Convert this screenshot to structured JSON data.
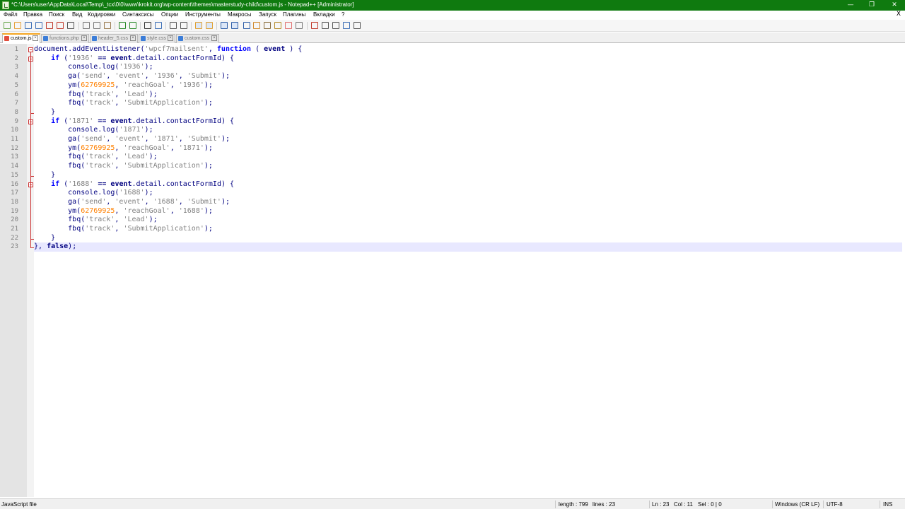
{
  "window": {
    "title": "*C:\\Users\\user\\AppData\\Local\\Temp\\_tcx\\0\\0\\www\\krokit.org\\wp-content\\themes\\masterstudy-child\\custom.js - Notepad++ [Administrator]",
    "minimize": "—",
    "maximize": "❐",
    "close": "✕"
  },
  "menu": {
    "items": [
      "Файл",
      "Правка",
      "Поиск",
      "Вид",
      "Кодировки",
      "Синтаксисы",
      "Опции",
      "Инструменты",
      "Макросы",
      "Запуск",
      "Плагины",
      "Вкладки",
      "?"
    ],
    "close_doc": "X"
  },
  "toolbar": {
    "icons": [
      "new-file-icon",
      "open-file-icon",
      "save-icon",
      "save-all-icon",
      "close-icon",
      "close-all-icon",
      "print-icon",
      "cut-icon",
      "copy-icon",
      "paste-icon",
      "undo-icon",
      "redo-icon",
      "find-icon",
      "replace-icon",
      "zoom-in-icon",
      "zoom-out-icon",
      "sync-vertical-icon",
      "sync-horizontal-icon",
      "word-wrap-icon",
      "show-all-chars-icon",
      "indent-guide-icon",
      "user-defined-lang-icon",
      "doc-map-icon",
      "function-list-icon",
      "folder-workspace-icon",
      "monitoring-icon",
      "record-macro-icon",
      "stop-macro-icon",
      "play-macro-icon",
      "run-macro-multiple-icon",
      "save-macro-icon"
    ]
  },
  "tabs": [
    {
      "label": "custom.js",
      "active": true
    },
    {
      "label": "functions.php",
      "active": false
    },
    {
      "label": "header_5.css",
      "active": false
    },
    {
      "label": "style.css",
      "active": false
    },
    {
      "label": "custom.css",
      "active": false
    }
  ],
  "code": {
    "lines": [
      [
        [
          "id",
          "document.addEventListener("
        ],
        [
          "str",
          "'wpcf7mailsent'"
        ],
        [
          "id",
          ", "
        ],
        [
          "kw",
          "function"
        ],
        [
          "id",
          " ( "
        ],
        [
          "op",
          "event"
        ],
        [
          "id",
          " ) {"
        ]
      ],
      [
        [
          "id",
          "    "
        ],
        [
          "kw",
          "if"
        ],
        [
          "id",
          " ("
        ],
        [
          "str",
          "'1936'"
        ],
        [
          "id",
          " "
        ],
        [
          "op",
          "=="
        ],
        [
          "id",
          " "
        ],
        [
          "op",
          "event"
        ],
        [
          "id",
          ".detail.contactFormId) {"
        ]
      ],
      [
        [
          "id",
          "        console.log("
        ],
        [
          "str",
          "'1936'"
        ],
        [
          "id",
          ");"
        ]
      ],
      [
        [
          "id",
          "        ga("
        ],
        [
          "str",
          "'send'"
        ],
        [
          "id",
          ", "
        ],
        [
          "str",
          "'event'"
        ],
        [
          "id",
          ", "
        ],
        [
          "str",
          "'1936'"
        ],
        [
          "id",
          ", "
        ],
        [
          "str",
          "'Submit'"
        ],
        [
          "id",
          ");"
        ]
      ],
      [
        [
          "id",
          "        ym("
        ],
        [
          "num",
          "62769925"
        ],
        [
          "id",
          ", "
        ],
        [
          "str",
          "'reachGoal'"
        ],
        [
          "id",
          ", "
        ],
        [
          "str",
          "'1936'"
        ],
        [
          "id",
          ");"
        ]
      ],
      [
        [
          "id",
          "        fbq("
        ],
        [
          "str",
          "'track'"
        ],
        [
          "id",
          ", "
        ],
        [
          "str",
          "'Lead'"
        ],
        [
          "id",
          ");"
        ]
      ],
      [
        [
          "id",
          "        fbq("
        ],
        [
          "str",
          "'track'"
        ],
        [
          "id",
          ", "
        ],
        [
          "str",
          "'SubmitApplication'"
        ],
        [
          "id",
          ");"
        ]
      ],
      [
        [
          "id",
          "    }"
        ]
      ],
      [
        [
          "id",
          "    "
        ],
        [
          "kw",
          "if"
        ],
        [
          "id",
          " ("
        ],
        [
          "str",
          "'1871'"
        ],
        [
          "id",
          " "
        ],
        [
          "op",
          "=="
        ],
        [
          "id",
          " "
        ],
        [
          "op",
          "event"
        ],
        [
          "id",
          ".detail.contactFormId) {"
        ]
      ],
      [
        [
          "id",
          "        console.log("
        ],
        [
          "str",
          "'1871'"
        ],
        [
          "id",
          ");"
        ]
      ],
      [
        [
          "id",
          "        ga("
        ],
        [
          "str",
          "'send'"
        ],
        [
          "id",
          ", "
        ],
        [
          "str",
          "'event'"
        ],
        [
          "id",
          ", "
        ],
        [
          "str",
          "'1871'"
        ],
        [
          "id",
          ", "
        ],
        [
          "str",
          "'Submit'"
        ],
        [
          "id",
          ");"
        ]
      ],
      [
        [
          "id",
          "        ym("
        ],
        [
          "num",
          "62769925"
        ],
        [
          "id",
          ", "
        ],
        [
          "str",
          "'reachGoal'"
        ],
        [
          "id",
          ", "
        ],
        [
          "str",
          "'1871'"
        ],
        [
          "id",
          ");"
        ]
      ],
      [
        [
          "id",
          "        fbq("
        ],
        [
          "str",
          "'track'"
        ],
        [
          "id",
          ", "
        ],
        [
          "str",
          "'Lead'"
        ],
        [
          "id",
          ");"
        ]
      ],
      [
        [
          "id",
          "        fbq("
        ],
        [
          "str",
          "'track'"
        ],
        [
          "id",
          ", "
        ],
        [
          "str",
          "'SubmitApplication'"
        ],
        [
          "id",
          ");"
        ]
      ],
      [
        [
          "id",
          "    }"
        ]
      ],
      [
        [
          "id",
          "    "
        ],
        [
          "kw",
          "if"
        ],
        [
          "id",
          " ("
        ],
        [
          "str",
          "'1688'"
        ],
        [
          "id",
          " "
        ],
        [
          "op",
          "=="
        ],
        [
          "id",
          " "
        ],
        [
          "op",
          "event"
        ],
        [
          "id",
          ".detail.contactFormId) {"
        ]
      ],
      [
        [
          "id",
          "        console.log("
        ],
        [
          "str",
          "'1688'"
        ],
        [
          "id",
          ");"
        ]
      ],
      [
        [
          "id",
          "        ga("
        ],
        [
          "str",
          "'send'"
        ],
        [
          "id",
          ", "
        ],
        [
          "str",
          "'event'"
        ],
        [
          "id",
          ", "
        ],
        [
          "str",
          "'1688'"
        ],
        [
          "id",
          ", "
        ],
        [
          "str",
          "'Submit'"
        ],
        [
          "id",
          ");"
        ]
      ],
      [
        [
          "id",
          "        ym("
        ],
        [
          "num",
          "62769925"
        ],
        [
          "id",
          ", "
        ],
        [
          "str",
          "'reachGoal'"
        ],
        [
          "id",
          ", "
        ],
        [
          "str",
          "'1688'"
        ],
        [
          "id",
          ");"
        ]
      ],
      [
        [
          "id",
          "        fbq("
        ],
        [
          "str",
          "'track'"
        ],
        [
          "id",
          ", "
        ],
        [
          "str",
          "'Lead'"
        ],
        [
          "id",
          ");"
        ]
      ],
      [
        [
          "id",
          "        fbq("
        ],
        [
          "str",
          "'track'"
        ],
        [
          "id",
          ", "
        ],
        [
          "str",
          "'SubmitApplication'"
        ],
        [
          "id",
          ");"
        ]
      ],
      [
        [
          "id",
          "    }"
        ]
      ],
      [
        [
          "id",
          "}, "
        ],
        [
          "op",
          "false"
        ],
        [
          "id",
          ");"
        ]
      ]
    ],
    "line_numbers": [
      "1",
      "2",
      "3",
      "4",
      "5",
      "6",
      "7",
      "8",
      "9",
      "10",
      "11",
      "12",
      "13",
      "14",
      "15",
      "16",
      "17",
      "18",
      "19",
      "20",
      "21",
      "22",
      "23"
    ],
    "current_line": 23
  },
  "status": {
    "file_type": "JavaScript file",
    "length": "length : 799",
    "lines": "lines : 23",
    "ln": "Ln : 23",
    "col": "Col : 11",
    "sel": "Sel : 0 | 0",
    "eol": "Windows (CR LF)",
    "encoding": "UTF-8",
    "mode": "INS"
  }
}
